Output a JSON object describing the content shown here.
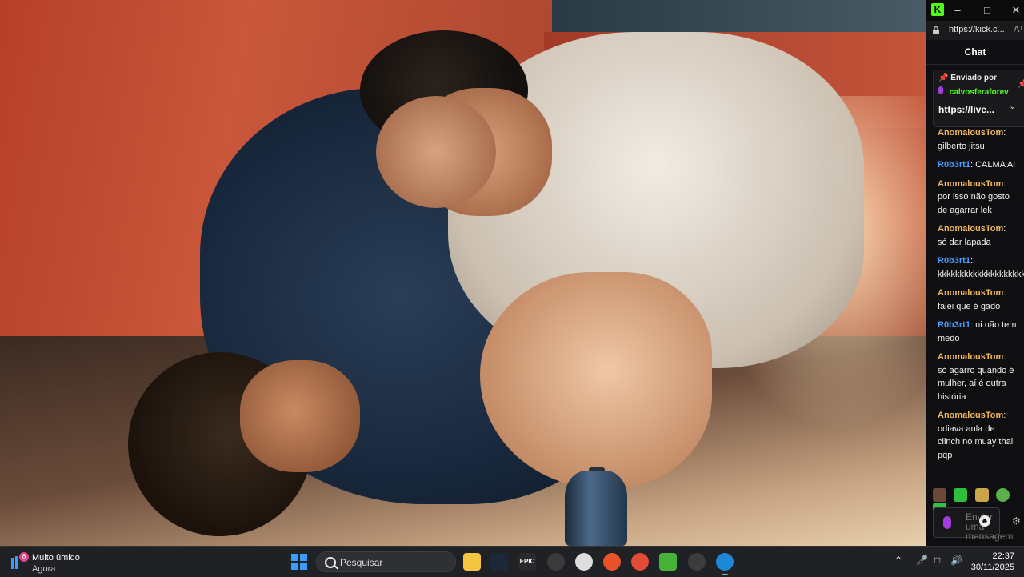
{
  "browser": {
    "url": "https://kick.c...",
    "reader_label": "Aᵀ"
  },
  "chat": {
    "title": "Chat",
    "pinned": {
      "label": "Enviado por",
      "user": "calvosferaforev",
      "link": "https://live..."
    },
    "messages": [
      {
        "user": "AnomalousTom",
        "color": "#f0b85a",
        "text": "gilberto jitsu"
      },
      {
        "user": "R0b3rt1",
        "color": "#4a9cff",
        "text": "CALMA AI"
      },
      {
        "user": "AnomalousTom",
        "color": "#f0b85a",
        "text": "por isso não gosto de agarrar lek"
      },
      {
        "user": "AnomalousTom",
        "color": "#f0b85a",
        "text": "só dar lapada"
      },
      {
        "user": "R0b3rt1",
        "color": "#4a9cff",
        "text": "kkkkkkkkkkkkkkkkkkkkkk"
      },
      {
        "user": "AnomalousTom",
        "color": "#f0b85a",
        "text": "falei que é gado"
      },
      {
        "user": "R0b3rt1",
        "color": "#4a9cff",
        "text": "ui não tem medo"
      },
      {
        "user": "AnomalousTom",
        "color": "#f0b85a",
        "text": "só agarro quando é mulher, aí é outra história"
      },
      {
        "user": "AnomalousTom",
        "color": "#f0b85a",
        "text": "odiava aula de clinch no muay thai pqp"
      }
    ],
    "input_placeholder": "Enviar uma mensagem"
  },
  "taskbar": {
    "weather_title": "Muito úmido",
    "weather_sub": "Agora",
    "weather_badge": "8",
    "search_placeholder": "Pesquisar",
    "time": "22:37",
    "date": "30/11/2025"
  },
  "colors": {
    "kick_green": "#53fc18",
    "username_orange": "#f0b85a",
    "username_blue": "#4a9cff"
  }
}
